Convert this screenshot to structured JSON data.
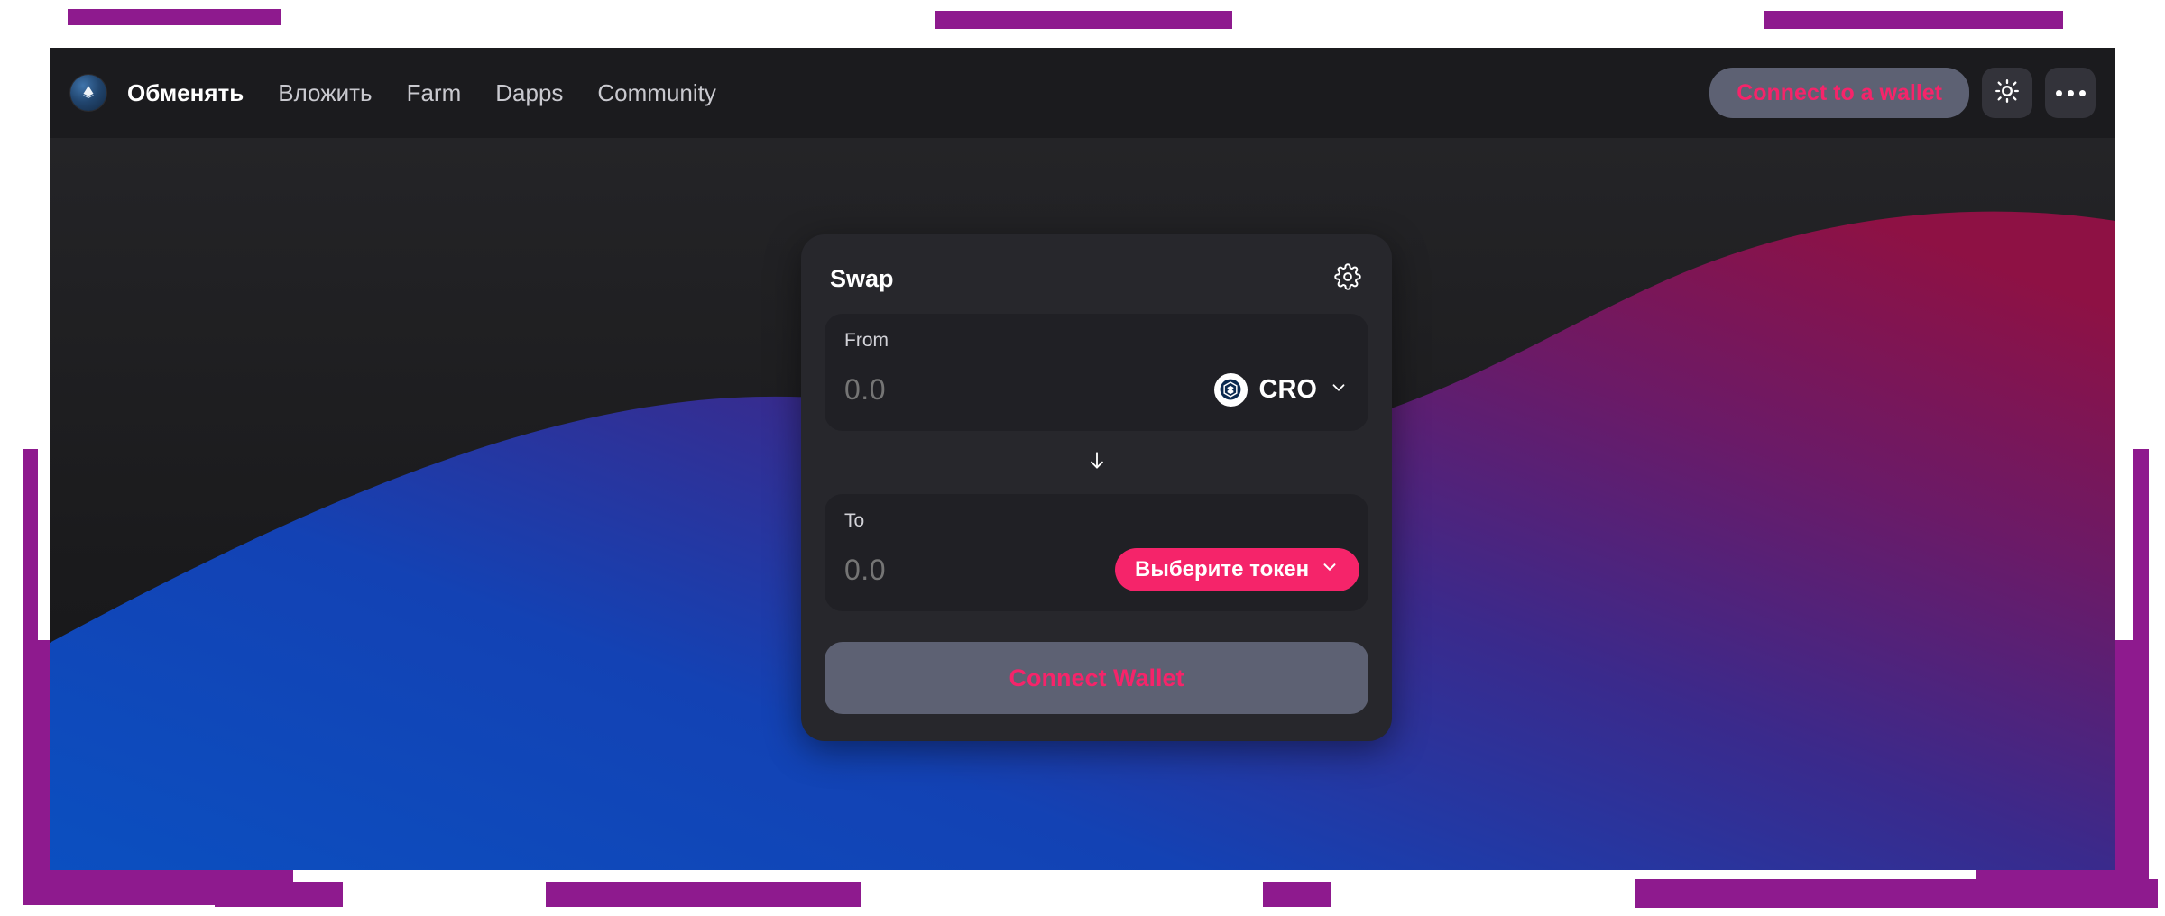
{
  "theme": {
    "accent_pink": "#f5246a",
    "redaction_purple": "#8e1a8e",
    "card_bg": "#27272c",
    "panel_bg": "#202025",
    "header_bg": "#1b1b1e",
    "button_gray": "#5d6173",
    "wave_blue": "#0b4fc0",
    "wave_purple": "#3a2a8c",
    "wave_magenta": "#8e1144"
  },
  "header": {
    "logo_icon": "token-diamond-icon",
    "nav": [
      {
        "label": "Обменять",
        "active": true
      },
      {
        "label": "Вложить",
        "active": false
      },
      {
        "label": "Farm",
        "active": false
      },
      {
        "label": "Dapps",
        "active": false
      },
      {
        "label": "Community",
        "active": false
      }
    ],
    "connect_label": "Connect to a wallet",
    "theme_toggle_icon": "sun-icon",
    "more_menu_icon": "ellipsis-icon"
  },
  "swap_card": {
    "title": "Swap",
    "settings_icon": "gear-icon",
    "from": {
      "label": "From",
      "amount_value": "",
      "amount_placeholder": "0.0",
      "token_symbol": "CRO",
      "token_icon": "cro-token-icon",
      "chevron_icon": "chevron-down-icon"
    },
    "switch_icon": "arrow-down-icon",
    "to": {
      "label": "To",
      "amount_value": "",
      "amount_placeholder": "0.0",
      "select_token_label": "Выберите токен",
      "chevron_icon": "chevron-down-icon"
    },
    "action_label": "Connect Wallet"
  }
}
